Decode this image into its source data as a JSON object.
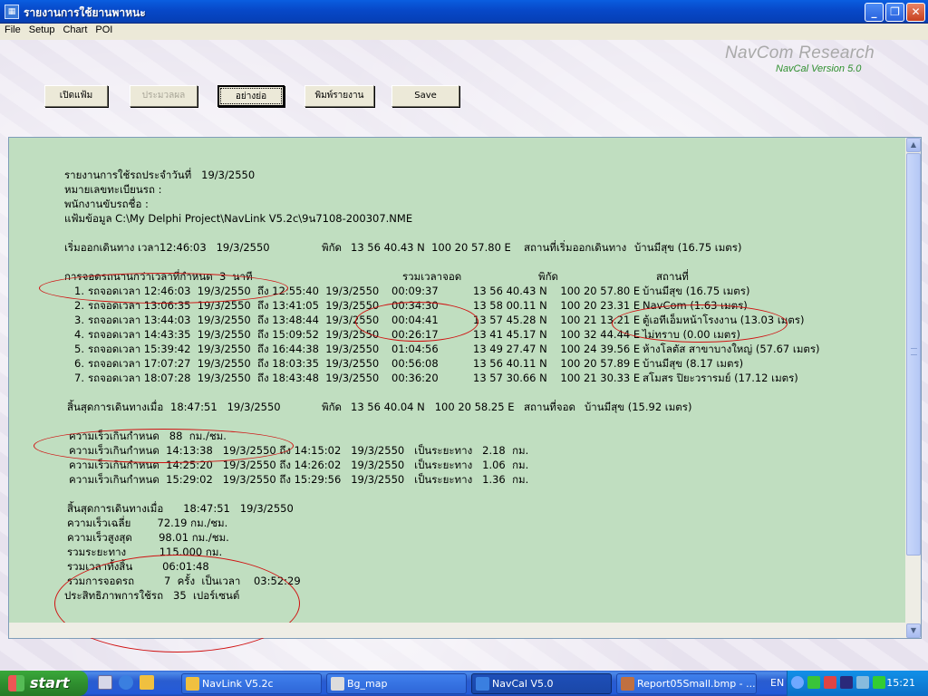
{
  "window": {
    "title": "รายงานการใช้ยานพาหนะ",
    "app_icon_glyph": "▦",
    "min_glyph": "_",
    "max_glyph": "❐",
    "close_glyph": "✕"
  },
  "menu": [
    "File",
    "Setup",
    "Chart",
    "POI"
  ],
  "brand": {
    "name": "NavCom Research",
    "version": "NavCal Version 5.0"
  },
  "toolbar": {
    "open_label": "เปิดแฟ้ม",
    "process_label": "ประมวลผล",
    "summary_label": "อย่างย่อ",
    "print_label": "พิมพ์รายงาน",
    "save_label": "Save"
  },
  "report": {
    "header": [
      "รายงานการใช้รถประจำวันที่   19/3/2550",
      "หมายเลขทะเบียนรถ :",
      "พนักงานขับรถชื่อ :",
      "แฟ้มข้อมูล C:\\My Delphi Project\\NavLink V5.2c\\9น7108-200307.NME"
    ],
    "start": {
      "label": "เริ่มออกเดินทาง เวลา",
      "value": "12:46:03   19/3/2550",
      "coord_label": "พิกัด",
      "coord": "13 56 40.43 N  100 20 57.80 E",
      "place_label": "สถานที่เริ่มออกเดินทาง",
      "place": "บ้านมีสุข (16.75 เมตร)"
    },
    "stops_header": {
      "title": "การจอดรถนานกว่าเวลาที่กำหนด  3  นาที",
      "col_total": "รวมเวลาจอด",
      "col_coord": "พิกัด",
      "col_place": "สถานที่"
    },
    "stops": [
      {
        "no": "1.",
        "range": "รถจอดเวลา 12:46:03  19/3/2550  ถึง 12:55:40  19/3/2550",
        "dur": "00:09:37",
        "coord": "13 56 40.43 N    100 20 57.80 E",
        "place": "บ้านมีสุข (16.75 เมตร)"
      },
      {
        "no": "2.",
        "range": "รถจอดเวลา 13:06:35  19/3/2550  ถึง 13:41:05  19/3/2550",
        "dur": "00:34:30",
        "coord": "13 58 00.11 N    100 20 23.31 E",
        "place": "NavCom (1.63 เมตร)"
      },
      {
        "no": "3.",
        "range": "รถจอดเวลา 13:44:03  19/3/2550  ถึง 13:48:44  19/3/2550",
        "dur": "00:04:41",
        "coord": "13 57 45.28 N    100 21 13.21 E",
        "place": "ตู้เอทีเอ็มหน้าโรงงาน (13.03 เมตร)"
      },
      {
        "no": "4.",
        "range": "รถจอดเวลา 14:43:35  19/3/2550  ถึง 15:09:52  19/3/2550",
        "dur": "00:26:17",
        "coord": "13 41 45.17 N    100 32 44.44 E",
        "place": "ไม่ทราบ (0.00 เมตร)"
      },
      {
        "no": "5.",
        "range": "รถจอดเวลา 15:39:42  19/3/2550  ถึง 16:44:38  19/3/2550",
        "dur": "01:04:56",
        "coord": "13 49 27.47 N    100 24 39.56 E",
        "place": "ห้างโลตัส สาขาบางใหญ่ (57.67 เมตร)"
      },
      {
        "no": "6.",
        "range": "รถจอดเวลา 17:07:27  19/3/2550  ถึง 18:03:35  19/3/2550",
        "dur": "00:56:08",
        "coord": "13 56 40.11 N    100 20 57.89 E",
        "place": "บ้านมีสุข (8.17 เมตร)"
      },
      {
        "no": "7.",
        "range": "รถจอดเวลา 18:07:28  19/3/2550  ถึง 18:43:48  19/3/2550",
        "dur": "00:36:20",
        "coord": "13 57 30.66 N    100 21 30.33 E",
        "place": "สโมสร ปิยะวรารมย์ (17.12 เมตร)"
      }
    ],
    "end": {
      "label": "สิ้นสุดการเดินทางเมื่อ",
      "value": "18:47:51   19/3/2550",
      "coord_label": "พิกัด",
      "coord": "13 56 40.04 N   100 20 58.25 E",
      "place_label": "สถานที่จอด",
      "place": "บ้านมีสุข (15.92 เมตร)"
    },
    "speeding": [
      "ความเร็วเกินกำหนด   88  กม./ชม.",
      "ความเร็วเกินกำหนด  14:13:38   19/3/2550 ถึง 14:15:02   19/3/2550   เป็นระยะทาง   2.18  กม.",
      "ความเร็วเกินกำหนด  14:25:20   19/3/2550 ถึง 14:26:02   19/3/2550   เป็นระยะทาง   1.06  กม.",
      "ความเร็วเกินกำหนด  15:29:02   19/3/2550 ถึง 15:29:56   19/3/2550   เป็นระยะทาง   1.36  กม."
    ],
    "summary": [
      "สิ้นสุดการเดินทางเมื่อ      18:47:51   19/3/2550",
      "ความเร็วเฉลี่ย        72.19 กม./ชม.",
      "ความเร็วสูงสุด        98.01 กม./ชม.",
      "รวมระยะทาง          115.000 กม.",
      "รวมเวลาทั้งสิ้น         06:01:48",
      "รวมการจอดรถ         7  ครั้ง  เป็นเวลา    03:52:29",
      "ประสิทธิภาพการใช้รถ   35  เปอร์เซนต์"
    ]
  },
  "taskbar": {
    "start_label": "start",
    "windows": [
      {
        "label": "NavLink V5.2c",
        "active": false
      },
      {
        "label": "Bg_map",
        "active": false
      },
      {
        "label": "NavCal  V5.0",
        "active": true
      },
      {
        "label": "Report05Small.bmp - ...",
        "active": false
      }
    ],
    "lang": "EN",
    "clock": "15:21"
  },
  "colors": {
    "report_bg": "#c0dec0",
    "annotation": "#d01010",
    "titlebar": "#0748c8"
  }
}
